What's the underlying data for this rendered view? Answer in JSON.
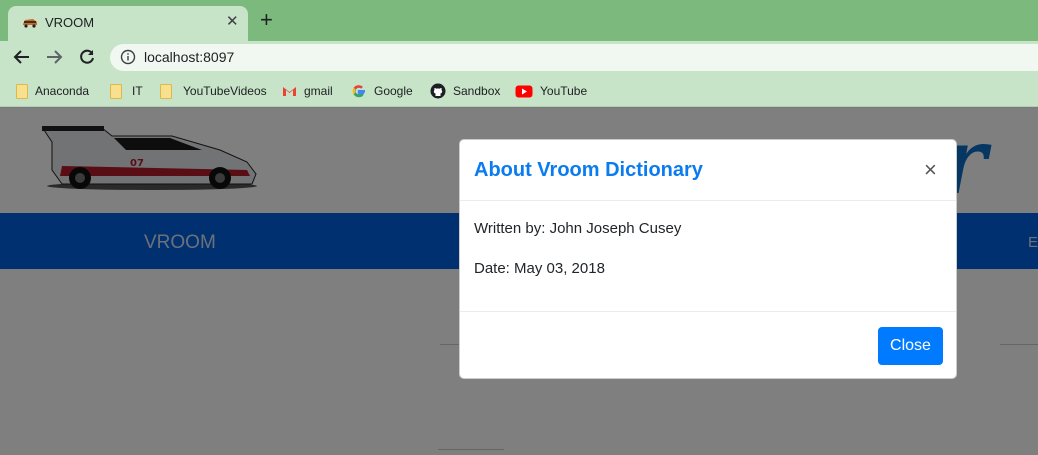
{
  "browser": {
    "tab_title": "VROOM",
    "url": "localhost:8097",
    "bookmarks": [
      {
        "label": "Anaconda",
        "icon": "folder-icon"
      },
      {
        "label": "IT",
        "icon": "folder-icon"
      },
      {
        "label": "YouTubeVideos",
        "icon": "folder-icon"
      },
      {
        "label": "gmail",
        "icon": "gmail-icon"
      },
      {
        "label": "Google",
        "icon": "google-icon"
      },
      {
        "label": "Sandbox",
        "icon": "github-icon"
      },
      {
        "label": "YouTube",
        "icon": "youtube-icon"
      }
    ]
  },
  "page": {
    "nav_brand": "VROOM",
    "nav_right_partial": "E",
    "colors": {
      "navbar": "#0060df",
      "accent": "#007bff",
      "title": "#0a7cf0"
    }
  },
  "modal": {
    "title": "About Vroom Dictionary",
    "written_by": "Written by: John Joseph Cusey",
    "date": "Date: May 03, 2018",
    "close_label": "Close",
    "dismiss_glyph": "×"
  }
}
